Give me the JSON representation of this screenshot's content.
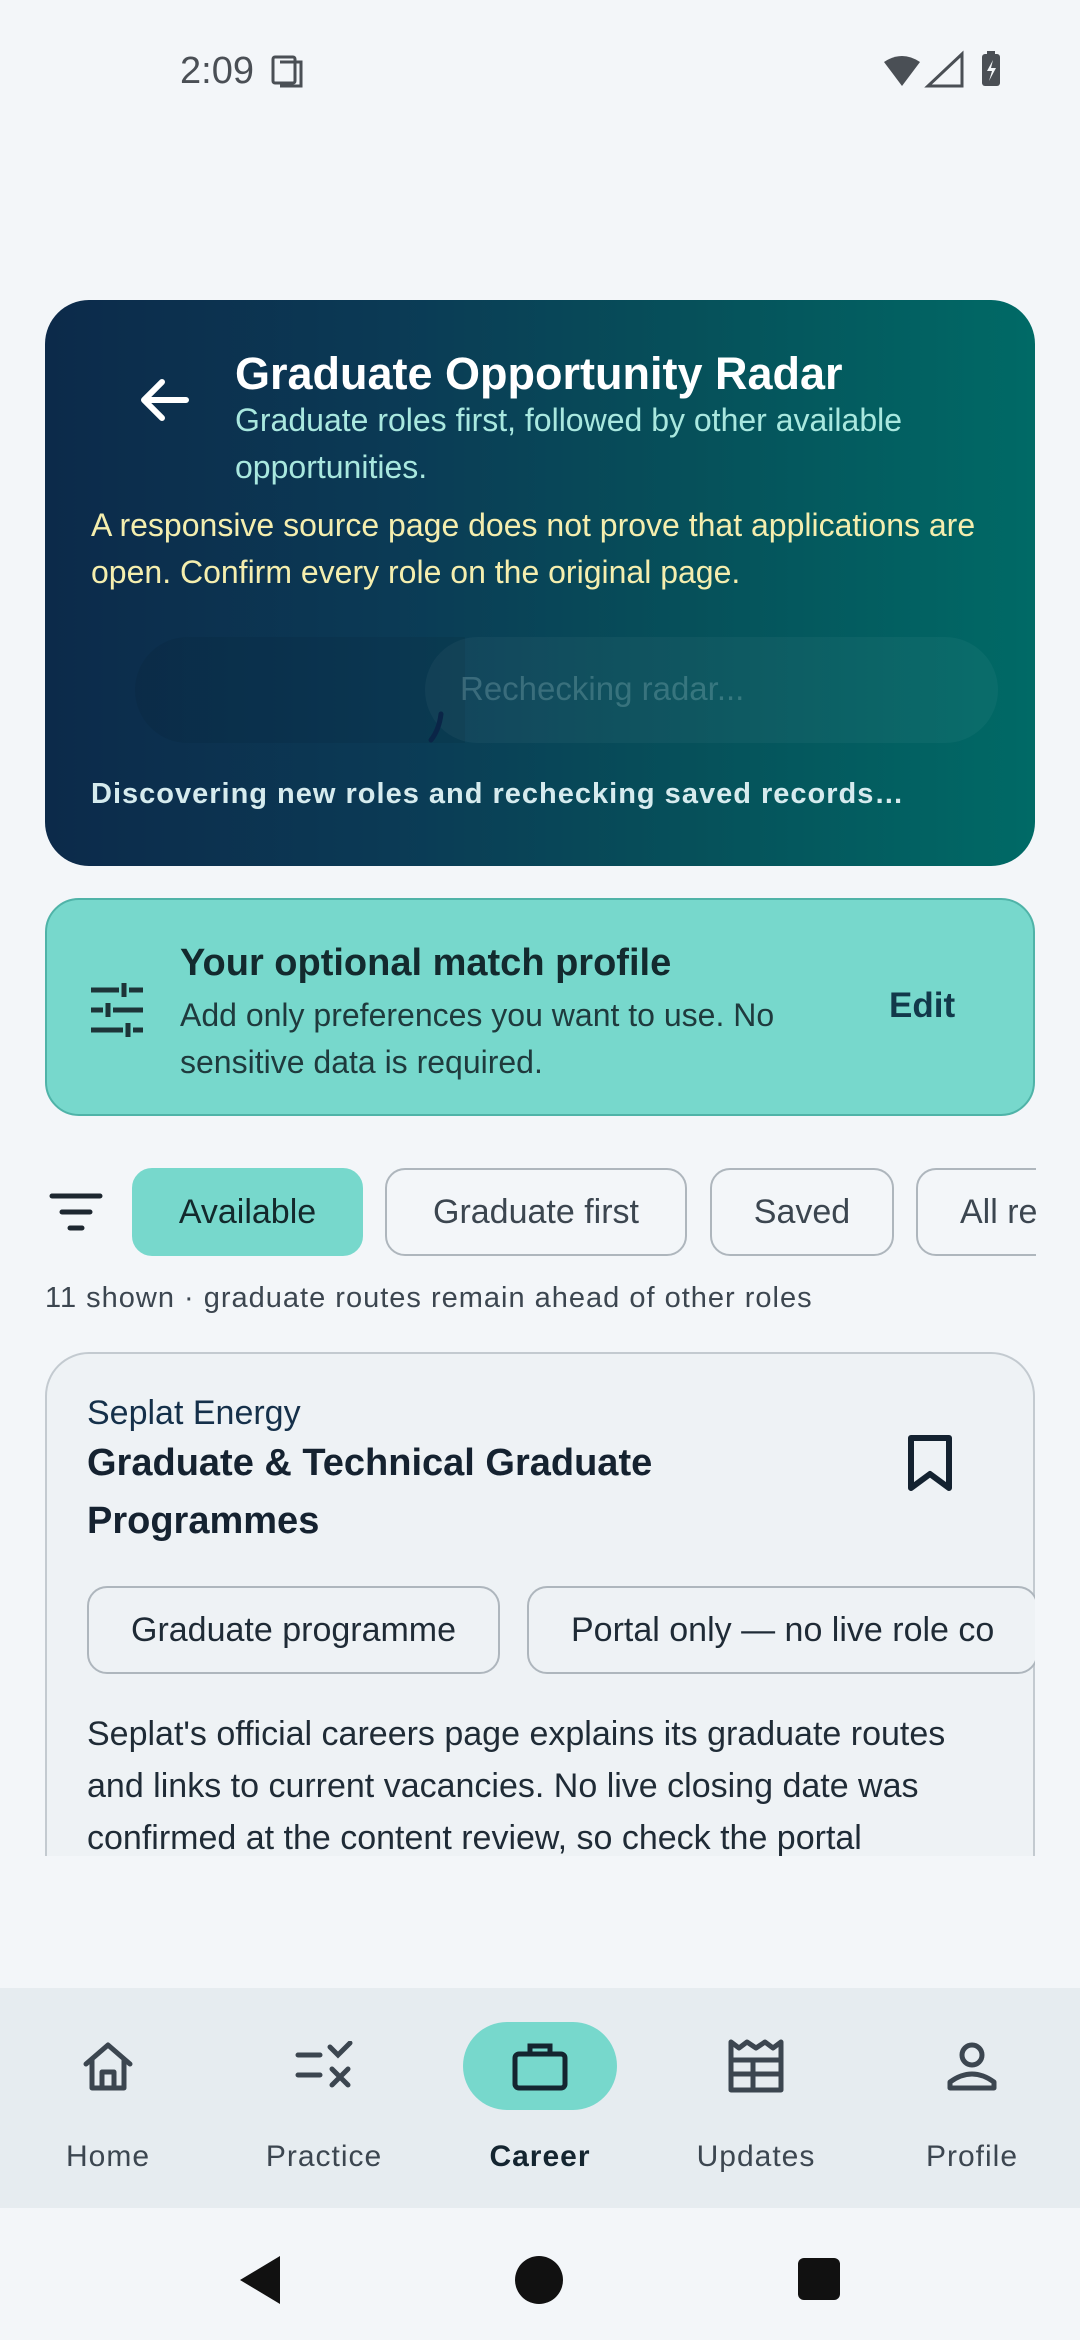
{
  "status_bar": {
    "time": "2:09"
  },
  "hero": {
    "title": "Graduate Opportunity Radar",
    "subtitle": "Graduate roles first, followed by other available opportunities.",
    "warning": "A responsive source page does not prove that applications are open. Confirm every role on the original page.",
    "recheck_button_label": "Rechecking radar...",
    "footer": "Discovering new roles and rechecking saved records…"
  },
  "match_profile": {
    "title": "Your optional match profile",
    "description": "Add only preferences you want to use. No sensitive data is required.",
    "edit_label": "Edit"
  },
  "filters": {
    "chips": [
      {
        "label": "Available",
        "selected": true
      },
      {
        "label": "Graduate first",
        "selected": false
      },
      {
        "label": "Saved",
        "selected": false
      },
      {
        "label": "All re",
        "selected": false
      }
    ]
  },
  "results": {
    "count_text": "11 shown · graduate routes remain ahead of other roles"
  },
  "job_card": {
    "company": "Seplat Energy",
    "title": "Graduate & Technical Graduate Programmes",
    "tags": [
      "Graduate programme",
      "Portal only — no live role co"
    ],
    "description": "Seplat's official careers page explains its graduate routes and links to current vacancies. No live closing date was confirmed at the content review, so check the portal"
  },
  "bottom_nav": {
    "items": [
      {
        "label": "Home",
        "icon": "home-icon"
      },
      {
        "label": "Practice",
        "icon": "practice-icon"
      },
      {
        "label": "Career",
        "icon": "briefcase-icon",
        "active": true
      },
      {
        "label": "Updates",
        "icon": "newspaper-icon"
      },
      {
        "label": "Profile",
        "icon": "person-icon"
      }
    ]
  },
  "colors": {
    "accent": "#77d8cc",
    "hero_start": "#0c2a4a",
    "hero_end": "#006a66",
    "warning_text": "#f5eeae"
  }
}
